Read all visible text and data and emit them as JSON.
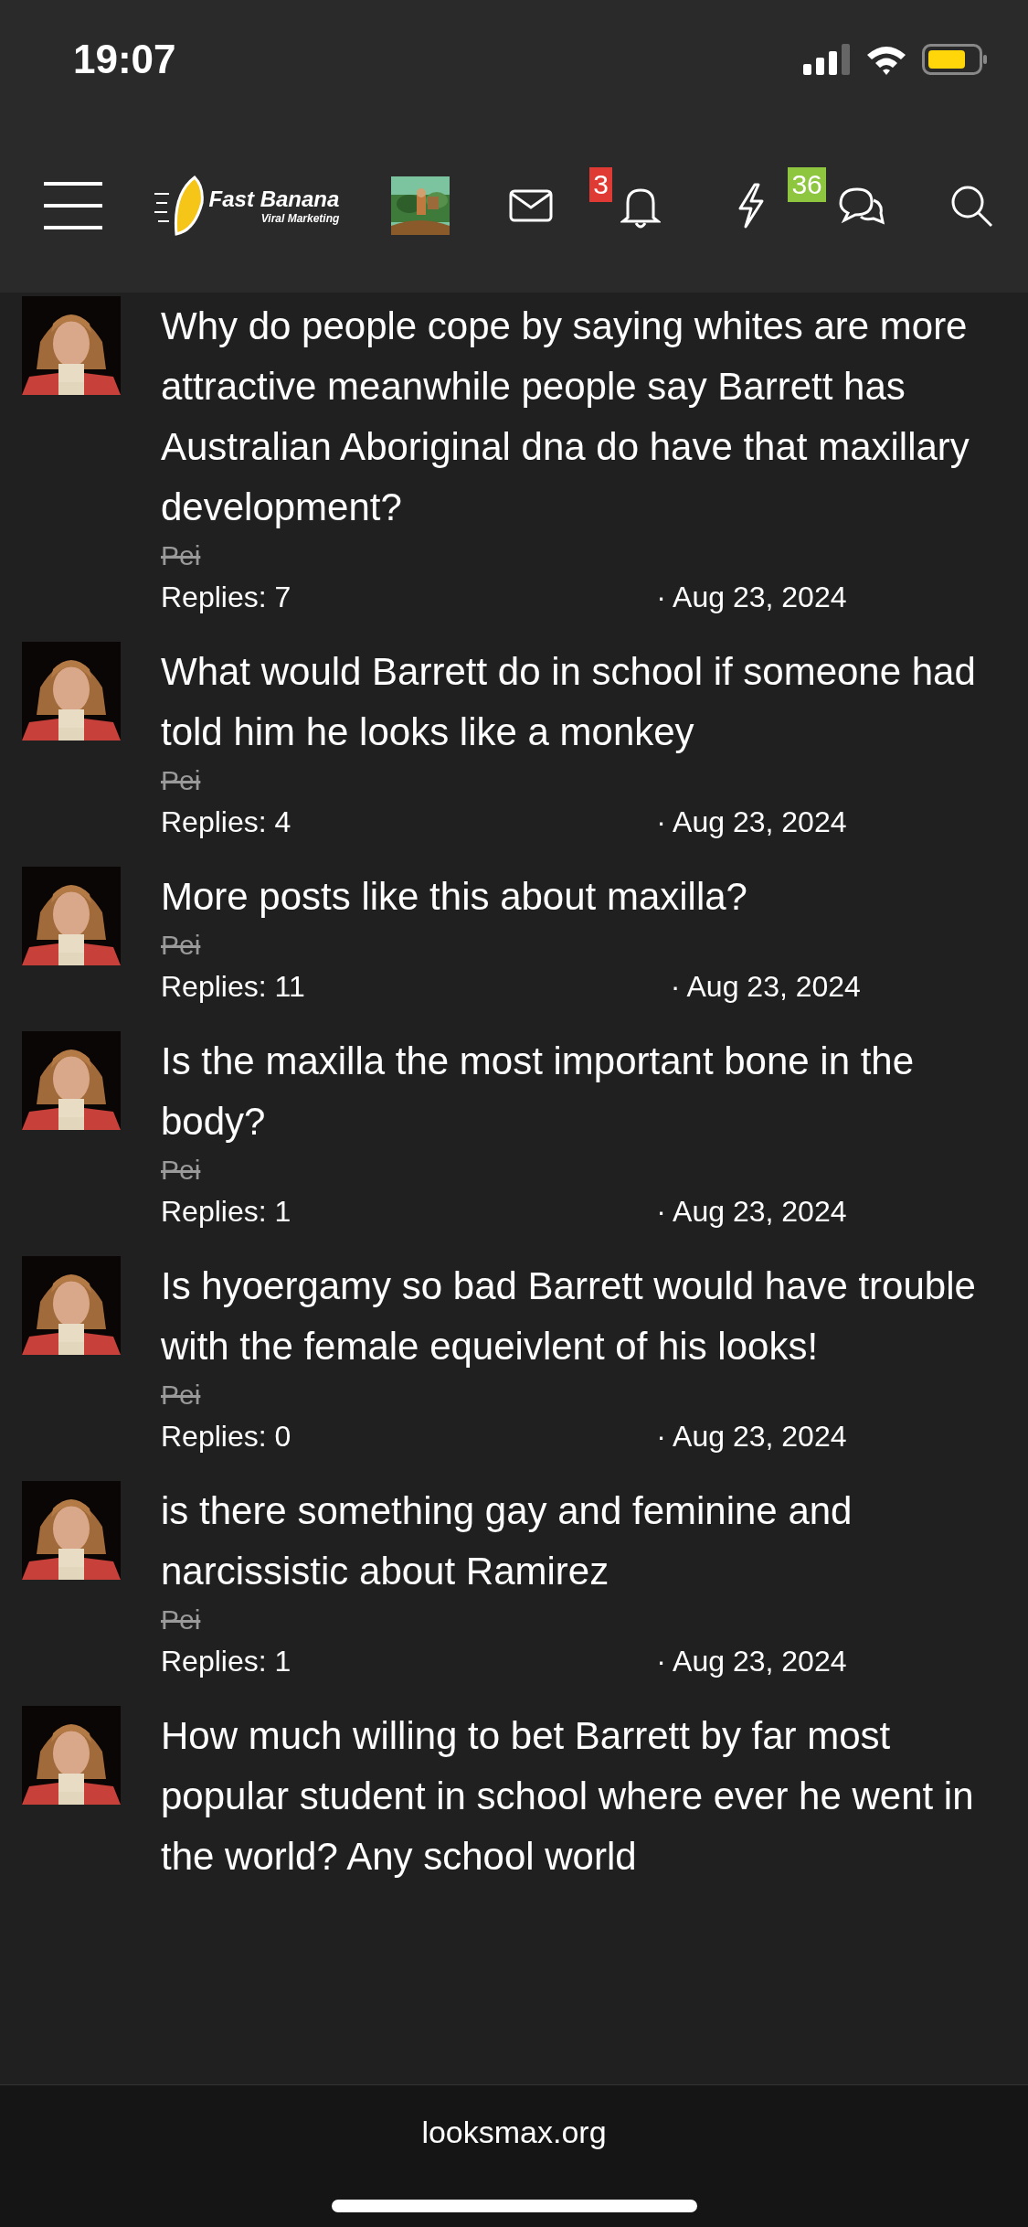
{
  "status_bar": {
    "time": "19:07"
  },
  "nav": {
    "logo": {
      "title": "Fast Banana",
      "subtitle": "Viral Marketing"
    },
    "badges": {
      "alerts": "3",
      "conversations": "36"
    }
  },
  "threads": [
    {
      "title": "Why do people cope by saying whites are more attractive meanwhile people say Barrett has Australian Aboriginal dna do have that maxillary development?",
      "author": "Pei",
      "replies": "Replies: 7",
      "date": "· Aug 23, 2024"
    },
    {
      "title": "What would Barrett do in school if someone had told him he looks like a monkey",
      "author": "Pei",
      "replies": "Replies: 4",
      "date": "· Aug 23, 2024"
    },
    {
      "title": "More posts like this about maxilla?",
      "author": "Pei",
      "replies": "Replies: 11",
      "date": "· Aug 23, 2024"
    },
    {
      "title": "Is the maxilla the most important bone in the body?",
      "author": "Pei",
      "replies": "Replies: 1",
      "date": "· Aug 23, 2024"
    },
    {
      "title": "Is hyoergamy so bad Barrett would have trouble with the female equeivlent of his looks!",
      "author": "Pei",
      "replies": "Replies: 0",
      "date": "· Aug 23, 2024"
    },
    {
      "title": "is there something gay and feminine and narcissistic about Ramirez",
      "author": "Pei",
      "replies": "Replies: 1",
      "date": "· Aug 23, 2024"
    },
    {
      "title": "How much willing to bet Barrett by far most popular student in school where ever he went in the world? Any school world"
    }
  ],
  "browser_bar": {
    "url": "looksmax.org"
  }
}
